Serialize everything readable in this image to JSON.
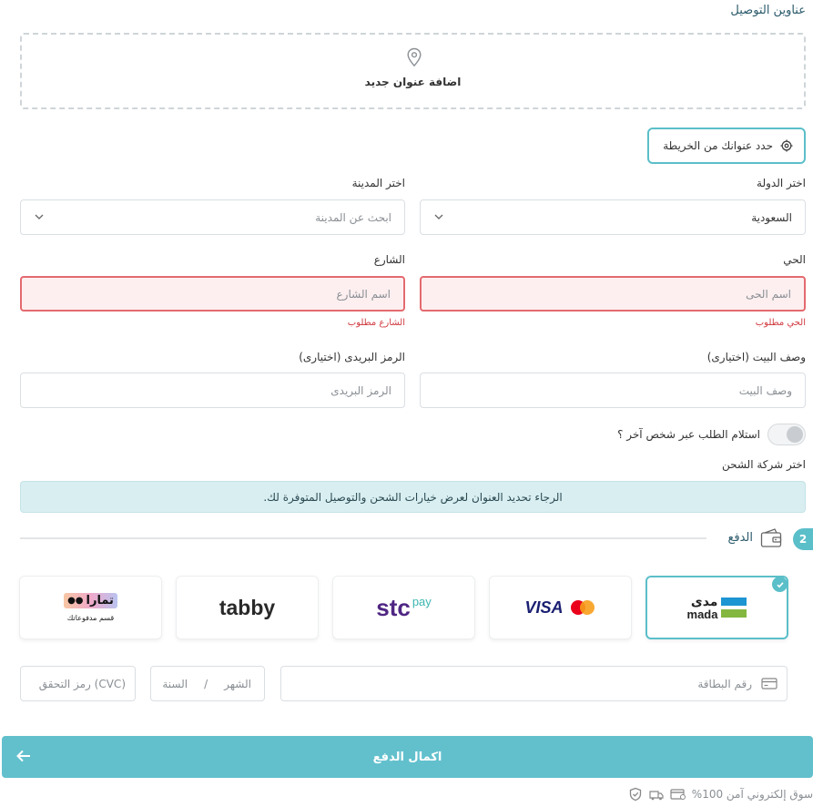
{
  "shipping": {
    "title": "عناوين التوصيل",
    "add_address": "اضافة عنوان جديد",
    "map_button": "حدد عنوانك من الخريطة",
    "country_label": "اختر الدولة",
    "country_value": "السعودية",
    "city_label": "اختر المدينة",
    "city_placeholder": "ابحث عن المدينة",
    "district_label": "الحي",
    "district_placeholder": "اسم الحى",
    "district_error": "الحي مطلوب",
    "street_label": "الشارع",
    "street_placeholder": "اسم الشارع",
    "street_error": "الشارع مطلوب",
    "house_label": "وصف البيت (اختيارى)",
    "house_placeholder": "وصف البيت",
    "postal_label": "الرمز البريدى (اختيارى)",
    "postal_placeholder": "الرمز البريدى",
    "other_person_label": "استلام الطلب عبر شخص آخر ؟",
    "other_person_on": false,
    "shipping_company_label": "اختر شركة الشحن",
    "shipping_info": "الرجاء تحديد العنوان لعرض خيارات الشحن والتوصيل المتوفرة لك."
  },
  "payment": {
    "step": "2",
    "title": "الدفع",
    "methods": {
      "mada_ar": "مدى",
      "mada_en": "mada",
      "visa": "VISA",
      "stc": "stc",
      "stc_pay": "pay",
      "tabby": "tabby",
      "tamara": "تمارا",
      "tamara_sub": "قسم مدفوعاتك"
    },
    "selected_method": "mada",
    "card_number_placeholder": "رقم البطاقة",
    "month_placeholder": "الشهر",
    "separator": "/",
    "year_placeholder": "السنة",
    "cvc_placeholder": "(CVC) رمز التحقق",
    "submit_label": "اكمال الدفع"
  },
  "footer": {
    "secure_text": "سوق إلكتروني آمن 100%"
  },
  "colors": {
    "accent": "#5bbfc9",
    "error": "#d0393f",
    "info_bg": "#d8eef1"
  }
}
